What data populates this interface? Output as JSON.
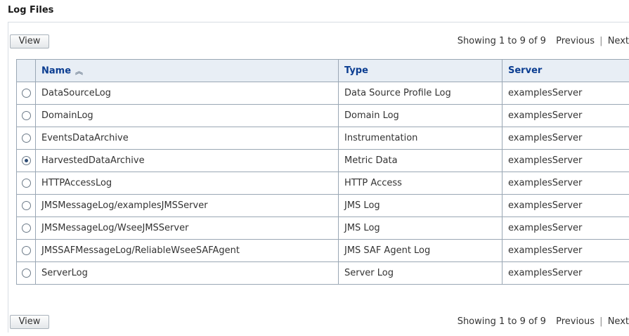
{
  "page": {
    "title": "Log Files"
  },
  "toolbar": {
    "view_label": "View",
    "showing": "Showing 1 to 9 of 9",
    "previous": "Previous",
    "separator": "|",
    "next": "Next"
  },
  "table": {
    "headers": {
      "name": "Name",
      "type": "Type",
      "server": "Server"
    },
    "sort_icon": "sort-ascending-icon",
    "selected_index": 3,
    "rows": [
      {
        "name": "DataSourceLog",
        "type": "Data Source Profile Log",
        "server": "examplesServer"
      },
      {
        "name": "DomainLog",
        "type": "Domain Log",
        "server": "examplesServer"
      },
      {
        "name": "EventsDataArchive",
        "type": "Instrumentation",
        "server": "examplesServer"
      },
      {
        "name": "HarvestedDataArchive",
        "type": "Metric Data",
        "server": "examplesServer"
      },
      {
        "name": "HTTPAccessLog",
        "type": "HTTP Access",
        "server": "examplesServer"
      },
      {
        "name": "JMSMessageLog/examplesJMSServer",
        "type": "JMS Log",
        "server": "examplesServer"
      },
      {
        "name": "JMSMessageLog/WseeJMSServer",
        "type": "JMS Log",
        "server": "examplesServer"
      },
      {
        "name": "JMSSAFMessageLog/ReliableWseeSAFAgent",
        "type": "JMS SAF Agent Log",
        "server": "examplesServer"
      },
      {
        "name": "ServerLog",
        "type": "Server Log",
        "server": "examplesServer"
      }
    ]
  },
  "colors": {
    "header_bg": "#e8eef5",
    "header_text": "#0b3d91",
    "grid_border": "#9aa7b4"
  }
}
